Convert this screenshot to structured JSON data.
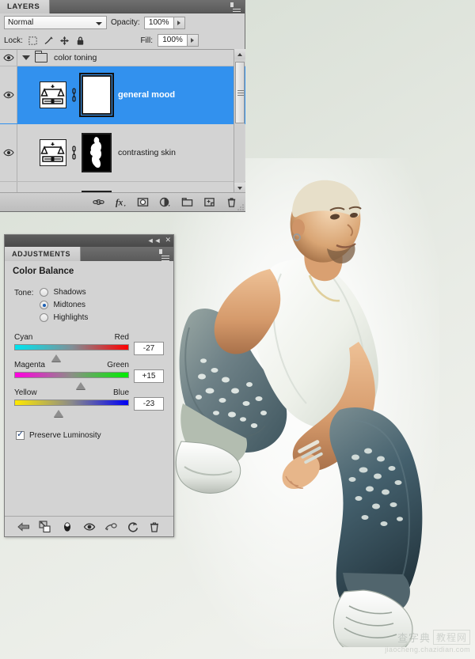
{
  "app": {
    "background_color": "#dfe4dc"
  },
  "layers_panel": {
    "tab_label": "LAYERS",
    "menu_icon": "panel-menu-icon",
    "blend_mode": "Normal",
    "opacity_label": "Opacity:",
    "opacity_value": "100%",
    "fill_label": "Fill:",
    "fill_value": "100%",
    "lock_label": "Lock:",
    "lock_icons": [
      "lock-transparent-pixels-icon",
      "lock-image-pixels-icon",
      "lock-position-icon",
      "lock-all-icon"
    ],
    "selection_color": "#3291ee",
    "rows": [
      {
        "name": "color toning",
        "type": "group",
        "visible": true,
        "selected": false,
        "icon": "folder-icon"
      },
      {
        "name": "general mood",
        "type": "adjustment",
        "visible": true,
        "selected": true,
        "icon": "color-balance-icon",
        "mask": "white"
      },
      {
        "name": "contrasting skin",
        "type": "adjustment",
        "visible": true,
        "selected": false,
        "icon": "color-balance-icon",
        "mask": "black-with-figure"
      },
      {
        "name": "",
        "type": "adjustment",
        "visible": true,
        "selected": false,
        "icon": "curves-icon",
        "mask": "black-with-figure"
      }
    ],
    "toolbar_icons": [
      "link-layers-icon",
      "add-layer-style-icon",
      "add-layer-mask-icon",
      "new-adjustment-layer-icon",
      "new-group-icon",
      "new-layer-icon",
      "delete-layer-icon"
    ]
  },
  "adjustments_panel": {
    "tab_label": "ADJUSTMENTS",
    "collapse_icon": "collapse-icon",
    "close_icon": "close-icon",
    "menu_icon": "panel-menu-icon",
    "title": "Color Balance",
    "tone_label": "Tone:",
    "tone_options": [
      {
        "label": "Shadows",
        "selected": false
      },
      {
        "label": "Midtones",
        "selected": true
      },
      {
        "label": "Highlights",
        "selected": false
      }
    ],
    "sliders": [
      {
        "left_label": "Cyan",
        "right_label": "Red",
        "value": "-27",
        "position_pct": 36.5,
        "track": "cyan-red"
      },
      {
        "left_label": "Magenta",
        "right_label": "Green",
        "value": "+15",
        "position_pct": 57.5,
        "track": "magenta-green"
      },
      {
        "left_label": "Yellow",
        "right_label": "Blue",
        "value": "-23",
        "position_pct": 38.5,
        "track": "yellow-blue"
      }
    ],
    "preserve_luminosity": {
      "label": "Preserve Luminosity",
      "checked": true
    },
    "toolbar_icons": [
      "return-to-adjustment-list-icon",
      "clip-to-layer-icon",
      "toggle-mask-icon",
      "preview-eye-icon",
      "clipping-mask-icon",
      "reset-icon",
      "delete-icon"
    ]
  },
  "watermark": {
    "cn_part1": "查字典",
    "cn_part2": "教程网",
    "url": "jiaocheng.chazidian.com"
  }
}
